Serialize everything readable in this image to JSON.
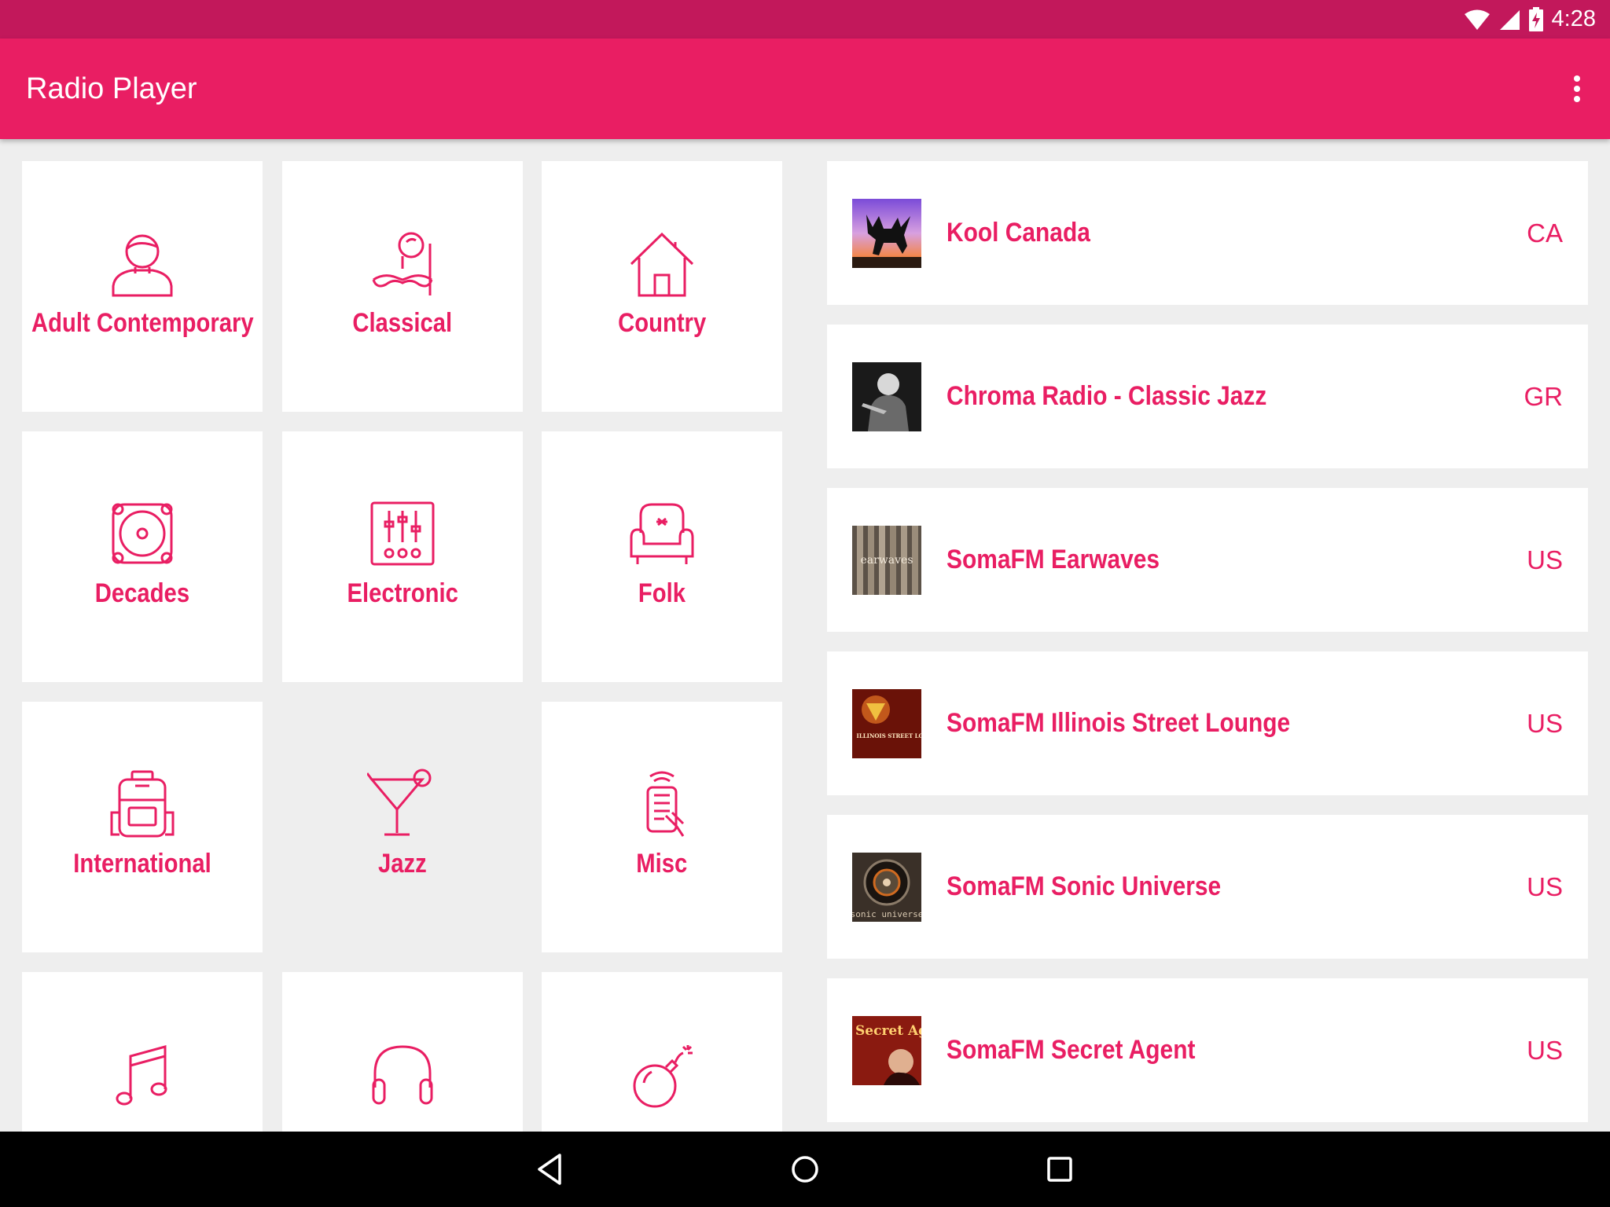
{
  "status_bar": {
    "time": "4:28",
    "icons": [
      "wifi-icon",
      "signal-icon",
      "battery-charging-icon"
    ]
  },
  "app_bar": {
    "title": "Radio Player",
    "menu_icon": "more-vert-icon"
  },
  "colors": {
    "accent": "#e91e63",
    "status_bar": "#c2185b",
    "background": "#eeeeee"
  },
  "genres": [
    {
      "label": "Adult Contemporary",
      "icon": "person-icon"
    },
    {
      "label": "Classical",
      "icon": "monocle-mustache-icon"
    },
    {
      "label": "Country",
      "icon": "house-icon"
    },
    {
      "label": "Decades",
      "icon": "speaker-icon"
    },
    {
      "label": "Electronic",
      "icon": "mixer-icon"
    },
    {
      "label": "Folk",
      "icon": "armchair-icon"
    },
    {
      "label": "International",
      "icon": "backpack-icon"
    },
    {
      "label": "Jazz",
      "icon": "cocktail-icon"
    },
    {
      "label": "Misc",
      "icon": "remote-control-icon"
    },
    {
      "label": "",
      "icon": "music-note-icon"
    },
    {
      "label": "",
      "icon": "headphones-icon"
    },
    {
      "label": "",
      "icon": "bomb-icon"
    }
  ],
  "stations": [
    {
      "name": "Kool Canada",
      "country": "CA"
    },
    {
      "name": "Chroma Radio - Classic Jazz",
      "country": "GR"
    },
    {
      "name": "SomaFM Earwaves",
      "country": "US"
    },
    {
      "name": "SomaFM Illinois Street Lounge",
      "country": "US"
    },
    {
      "name": "SomaFM Sonic Universe",
      "country": "US"
    },
    {
      "name": "SomaFM Secret Agent",
      "country": "US"
    }
  ],
  "station_thumb_text": {
    "earwaves": "earwaves",
    "illinois": "ILLINOIS STREET LOUNGE",
    "sonic": "sonic universe",
    "secret": "Secret Agent"
  },
  "nav_bar": {
    "buttons": [
      "back-icon",
      "home-icon",
      "recents-icon"
    ]
  }
}
